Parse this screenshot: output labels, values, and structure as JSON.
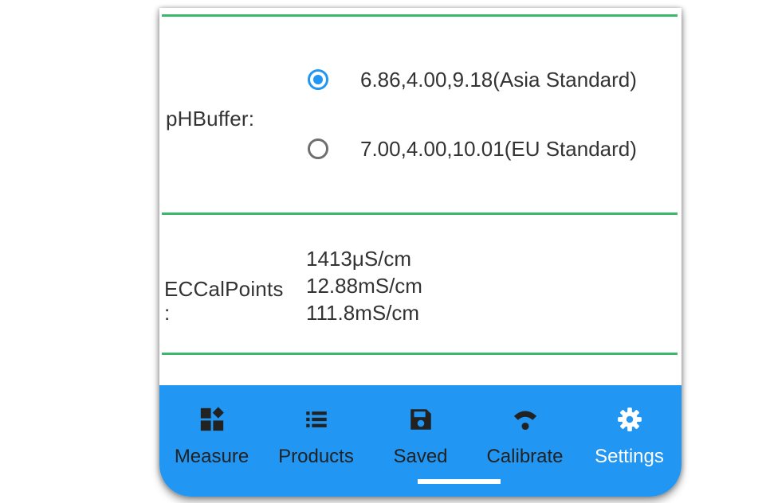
{
  "ph_buffer": {
    "label": "pHBuffer:",
    "options": [
      {
        "text": "6.86,4.00,9.18(Asia Standard)",
        "selected": true
      },
      {
        "text": "7.00,4.00,10.01(EU Standard)",
        "selected": false
      }
    ]
  },
  "ec_cal": {
    "label_line1": "ECCalPoints",
    "label_line2": ":",
    "points": [
      "1413μS/cm",
      "12.88mS/cm",
      "111.8mS/cm"
    ]
  },
  "nav": {
    "items": [
      {
        "label": "Measure",
        "icon": "dashboard-icon"
      },
      {
        "label": "Products",
        "icon": "list-icon"
      },
      {
        "label": "Saved",
        "icon": "save-icon"
      },
      {
        "label": "Calibrate",
        "icon": "calibrate-icon"
      },
      {
        "label": "Settings",
        "icon": "gear-icon"
      }
    ],
    "active": "Settings"
  },
  "colors": {
    "accent": "#2196f3",
    "divider": "#3db86a",
    "text": "#333333",
    "nav_text": "#222222",
    "nav_active_text": "#ffffff"
  }
}
